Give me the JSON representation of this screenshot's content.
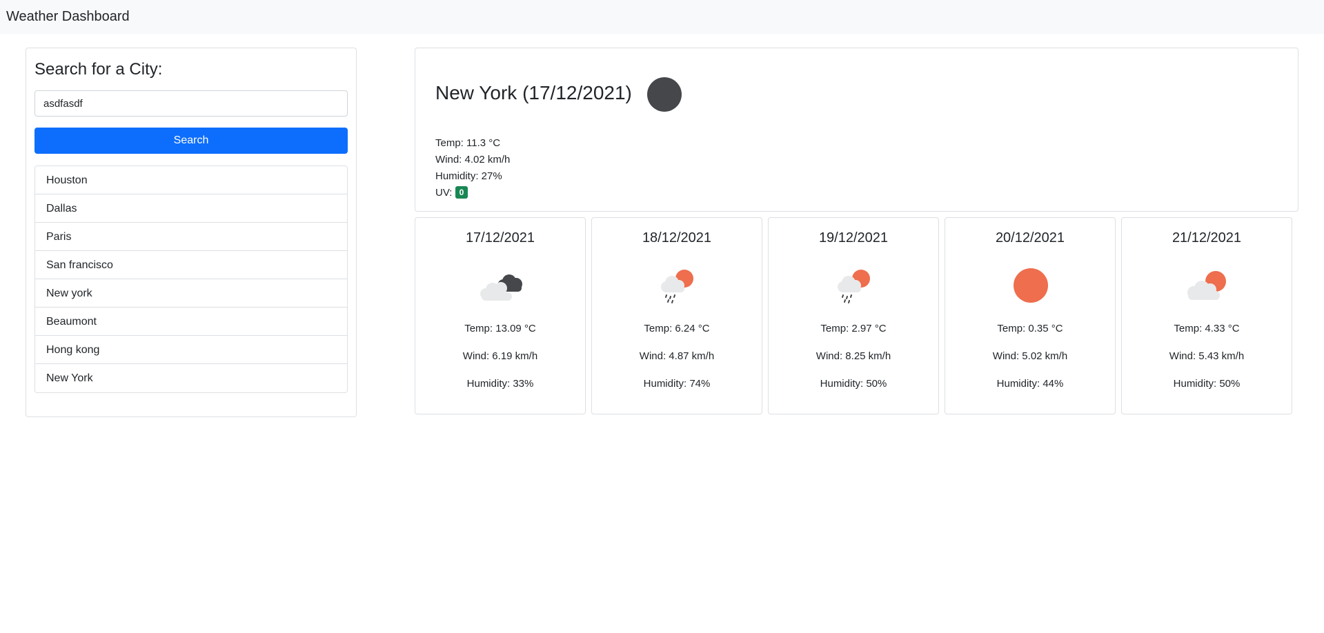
{
  "app": {
    "title": "Weather Dashboard"
  },
  "search": {
    "heading": "Search for a City:",
    "input_value": "asdfasdf",
    "button_label": "Search",
    "history": [
      "Houston",
      "Dallas",
      "Paris",
      "San francisco",
      "New york",
      "Beaumont",
      "Hong kong",
      "New York"
    ]
  },
  "current": {
    "title": "New York (17/12/2021)",
    "icon": "moon-dark-icon",
    "temp": "Temp: 11.3 °C",
    "wind": "Wind: 4.02 km/h",
    "humidity": "Humidity: 27%",
    "uv_label": "UV:",
    "uv_value": "0",
    "uv_color": "#198754"
  },
  "forecast": [
    {
      "date": "17/12/2021",
      "icon": "broken-clouds-icon",
      "temp": "Temp: 13.09 °C",
      "wind": "Wind: 6.19 km/h",
      "humidity": "Humidity: 33%"
    },
    {
      "date": "18/12/2021",
      "icon": "rain-sun-icon",
      "temp": "Temp: 6.24 °C",
      "wind": "Wind: 4.87 km/h",
      "humidity": "Humidity: 74%"
    },
    {
      "date": "19/12/2021",
      "icon": "rain-sun-icon",
      "temp": "Temp: 2.97 °C",
      "wind": "Wind: 8.25 km/h",
      "humidity": "Humidity: 50%"
    },
    {
      "date": "20/12/2021",
      "icon": "clear-sun-icon",
      "temp": "Temp: 0.35 °C",
      "wind": "Wind: 5.02 km/h",
      "humidity": "Humidity: 44%"
    },
    {
      "date": "21/12/2021",
      "icon": "cloud-sun-icon",
      "temp": "Temp: 4.33 °C",
      "wind": "Wind: 5.43 km/h",
      "humidity": "Humidity: 50%"
    }
  ],
  "colors": {
    "accent": "#0d6efd",
    "sun": "#ee6e4d",
    "cloud": "#e8e9ea",
    "dark_cloud": "#45474a"
  }
}
